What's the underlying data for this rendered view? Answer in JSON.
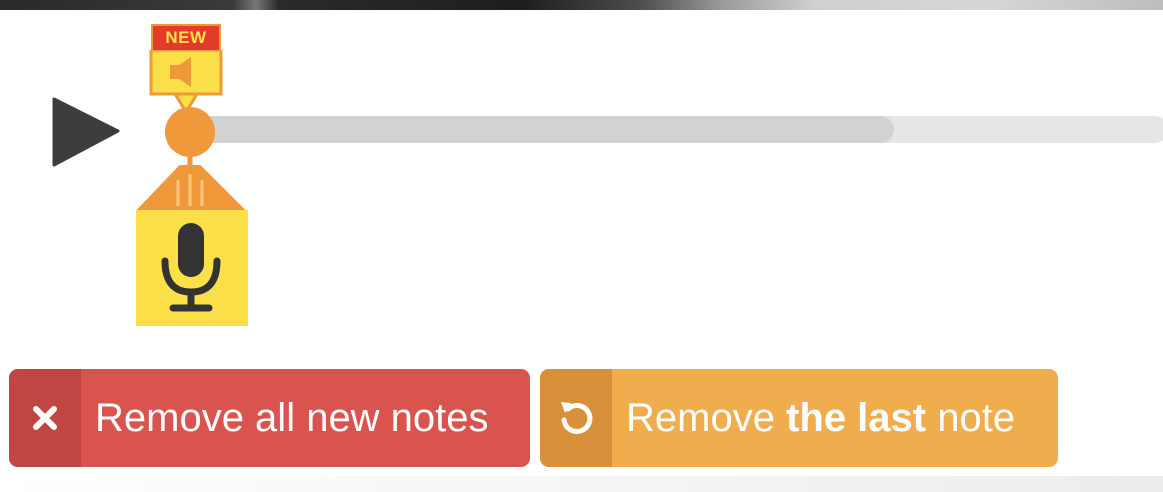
{
  "player": {
    "play_label": "play",
    "progress_fraction": 0.72
  },
  "new_note": {
    "badge_text": "NEW",
    "icon": "speaker-icon"
  },
  "recorder": {
    "icon": "microphone-icon"
  },
  "actions": {
    "remove_all": {
      "icon": "close-icon",
      "label": "Remove all new notes"
    },
    "remove_last": {
      "icon": "undo-icon",
      "label_prefix": "Remove ",
      "label_bold": "the last",
      "label_suffix": " note"
    }
  },
  "colors": {
    "danger": "#d9534f",
    "warning": "#f0ad4e",
    "accent_orange": "#f0993a",
    "marker_yellow": "#fbe04a",
    "badge_red": "#e23b2b"
  }
}
